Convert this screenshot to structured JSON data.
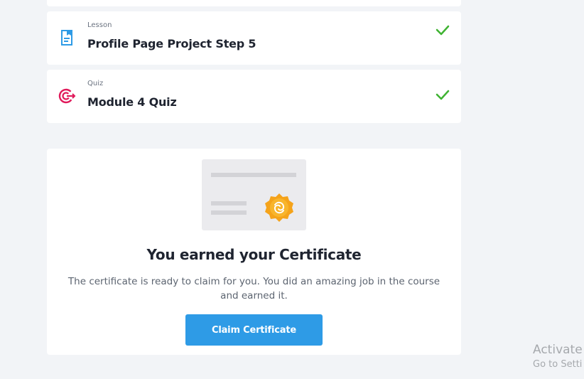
{
  "items": [
    {
      "type": "Lesson",
      "title": "Profile Page Project Step 5",
      "icon": "lesson-document-icon",
      "completed": true
    },
    {
      "type": "Quiz",
      "title": "Module 4 Quiz",
      "icon": "quiz-target-icon",
      "completed": true
    }
  ],
  "certificate": {
    "heading": "You earned your Certificate",
    "description": "The certificate is ready to claim for you. You did an amazing job in the course and earned it.",
    "button_label": "Claim Certificate",
    "illustration_icon": "certificate-badge-icon"
  },
  "watermark": {
    "line1": "Activate",
    "line2": "Go to Setti"
  },
  "colors": {
    "background": "#f2f4f7",
    "accent": "#2e9be6",
    "check": "#3fb332",
    "quiz_icon": "#e0195a",
    "lesson_icon": "#2e9be6",
    "badge": "#f5a31a"
  }
}
